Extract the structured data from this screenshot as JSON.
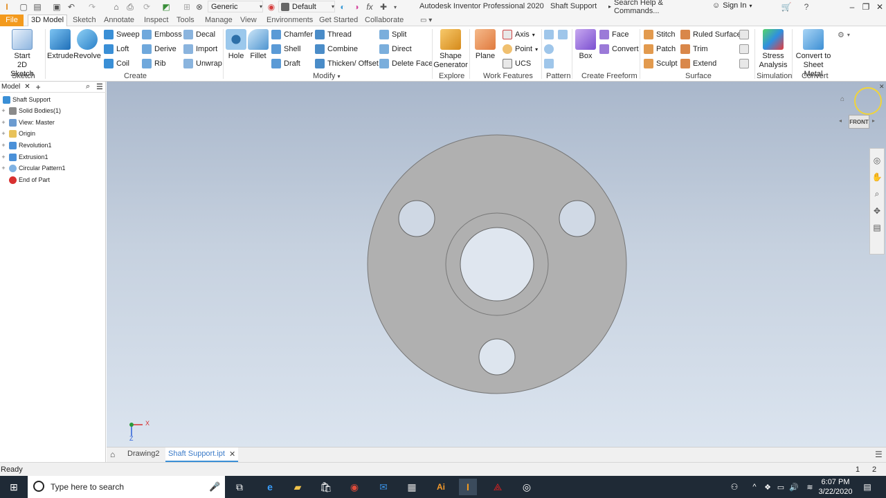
{
  "app": {
    "title": "Autodesk Inventor Professional 2020",
    "document": "Shaft Support",
    "search_placeholder": "Search Help & Commands...",
    "sign_in": "Sign In",
    "material": "Generic",
    "appearance": "Default",
    "accent": "#f39a1d"
  },
  "tabs": [
    "File",
    "3D Model",
    "Sketch",
    "Annotate",
    "Inspect",
    "Tools",
    "Manage",
    "View",
    "Environments",
    "Get Started",
    "Collaborate"
  ],
  "ribbon": {
    "sketch": {
      "start": "Start",
      "sketch2d": "2D Sketch",
      "panel": "Sketch"
    },
    "create": {
      "extrude": "Extrude",
      "revolve": "Revolve",
      "sweep": "Sweep",
      "loft": "Loft",
      "coil": "Coil",
      "emboss": "Emboss",
      "derive": "Derive",
      "rib": "Rib",
      "decal": "Decal",
      "import": "Import",
      "unwrap": "Unwrap",
      "panel": "Create"
    },
    "modify": {
      "hole": "Hole",
      "fillet": "Fillet",
      "chamfer": "Chamfer",
      "shell": "Shell",
      "draft": "Draft",
      "thread": "Thread",
      "combine": "Combine",
      "thicken": "Thicken/ Offset",
      "split": "Split",
      "direct": "Direct",
      "delete_face": "Delete Face",
      "panel": "Modify"
    },
    "explore": {
      "shape": "Shape",
      "generator": "Generator",
      "panel": "Explore"
    },
    "work": {
      "plane": "Plane",
      "axis": "Axis",
      "point": "Point",
      "ucs": "UCS",
      "panel": "Work Features"
    },
    "pattern": {
      "panel": "Pattern"
    },
    "freeform": {
      "box": "Box",
      "face": "Face",
      "convert": "Convert",
      "panel": "Create Freeform"
    },
    "surface": {
      "stitch": "Stitch",
      "patch": "Patch",
      "sculpt": "Sculpt",
      "ruled": "Ruled Surface",
      "trim": "Trim",
      "extend": "Extend",
      "panel": "Surface"
    },
    "simulation": {
      "stress": "Stress",
      "analysis": "Analysis",
      "panel": "Simulation"
    },
    "convert": {
      "convert_to": "Convert to",
      "sheet_metal": "Sheet Metal",
      "panel": "Convert"
    }
  },
  "browser": {
    "tab": "Model",
    "items": [
      "Shaft Support",
      "Solid Bodies(1)",
      "View: Master",
      "Origin",
      "Revolution1",
      "Extrusion1",
      "Circular Pattern1",
      "End of Part"
    ]
  },
  "viewcube": {
    "face": "FRONT"
  },
  "triad": {
    "x": "X",
    "z": "Z"
  },
  "doc_tabs": [
    "Drawing2",
    "Shaft Support.ipt"
  ],
  "status": {
    "text": "Ready",
    "n1": "1",
    "n2": "2"
  },
  "taskbar": {
    "search": "Type here to search",
    "time": "6:07 PM",
    "date": "3/22/2020"
  }
}
